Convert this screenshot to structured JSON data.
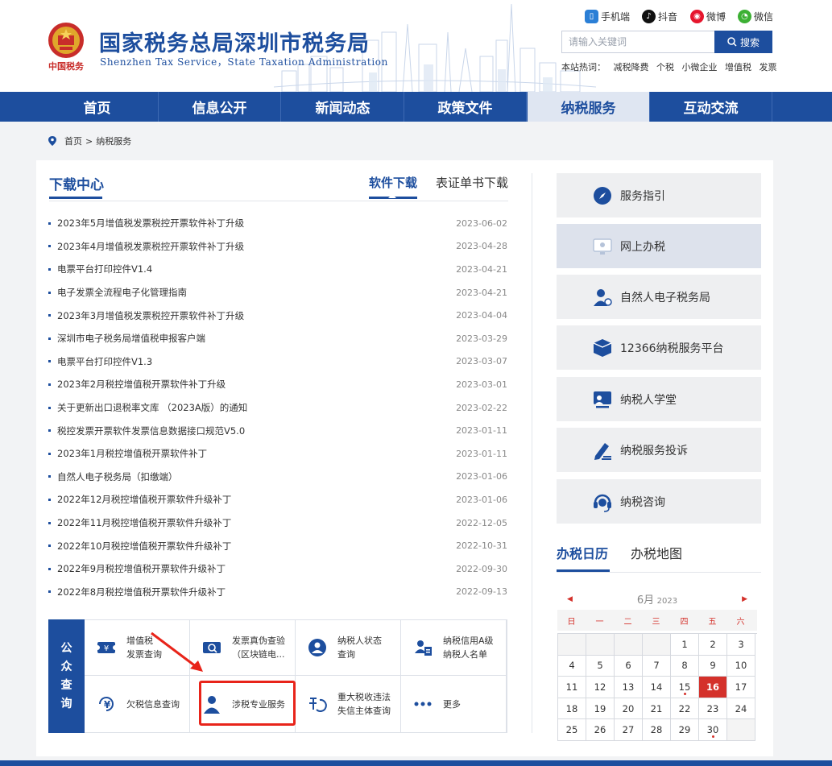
{
  "header": {
    "title": "国家税务总局深圳市税务局",
    "subtitle": "Shenzhen Tax Service，State Taxation Administration",
    "emblem_text": "中国税务",
    "social": [
      "手机端",
      "抖音",
      "微博",
      "微信"
    ],
    "search_placeholder": "请输入关键词",
    "search_button": "搜索",
    "hot_label": "本站热词：",
    "hot_words": [
      "减税降费",
      "个税",
      "小微企业",
      "增值税",
      "发票"
    ]
  },
  "nav": {
    "items": [
      "首页",
      "信息公开",
      "新闻动态",
      "政策文件",
      "纳税服务",
      "互动交流"
    ],
    "active_index": 4
  },
  "breadcrumb": {
    "home": "首页",
    "sep": ">",
    "current": "纳税服务"
  },
  "download": {
    "title": "下载中心",
    "tabs": [
      "软件下载",
      "表证单书下载"
    ],
    "items": [
      {
        "title": "2023年5月增值税发票税控开票软件补丁升级",
        "date": "2023-06-02"
      },
      {
        "title": "2023年4月增值税发票税控开票软件补丁升级",
        "date": "2023-04-28"
      },
      {
        "title": "电票平台打印控件V1.4",
        "date": "2023-04-21"
      },
      {
        "title": "电子发票全流程电子化管理指南",
        "date": "2023-04-21"
      },
      {
        "title": "2023年3月增值税发票税控开票软件补丁升级",
        "date": "2023-04-04"
      },
      {
        "title": "深圳市电子税务局增值税申报客户端",
        "date": "2023-03-29"
      },
      {
        "title": "电票平台打印控件V1.3",
        "date": "2023-03-07"
      },
      {
        "title": "2023年2月税控增值税开票软件补丁升级",
        "date": "2023-03-01"
      },
      {
        "title": "关于更新出口退税率文库 （2023A版）的通知",
        "date": "2023-02-22"
      },
      {
        "title": "税控发票开票软件发票信息数据接口规范V5.0",
        "date": "2023-01-11"
      },
      {
        "title": "2023年1月税控增值税开票软件补丁",
        "date": "2023-01-11"
      },
      {
        "title": "自然人电子税务局（扣缴端）",
        "date": "2023-01-06"
      },
      {
        "title": "2022年12月税控增值税开票软件升级补丁",
        "date": "2023-01-06"
      },
      {
        "title": "2022年11月税控增值税开票软件升级补丁",
        "date": "2022-12-05"
      },
      {
        "title": "2022年10月税控增值税开票软件升级补丁",
        "date": "2022-10-31"
      },
      {
        "title": "2022年9月税控增值税开票软件升级补丁",
        "date": "2022-09-30"
      },
      {
        "title": "2022年8月税控增值税开票软件升级补丁",
        "date": "2022-09-13"
      }
    ]
  },
  "public_query": {
    "label": [
      "公",
      "众",
      "查",
      "询"
    ],
    "cells": [
      {
        "l1": "增值税",
        "l2": "发票查询"
      },
      {
        "l1": "发票真伪查验",
        "l2": "（区块链电..."
      },
      {
        "l1": "纳税人状态",
        "l2": "查询"
      },
      {
        "l1": "纳税信用A级",
        "l2": "纳税人名单"
      },
      {
        "l1": "欠税信息查询",
        "l2": ""
      },
      {
        "l1": "涉税专业服务",
        "l2": ""
      },
      {
        "l1": "重大税收违法",
        "l2": "失信主体查询"
      },
      {
        "l1": "更多",
        "l2": ""
      }
    ]
  },
  "services": {
    "items": [
      "服务指引",
      "网上办税",
      "自然人电子税务局",
      "12366纳税服务平台",
      "纳税人学堂",
      "纳税服务投诉",
      "纳税咨询"
    ],
    "active_index": 1
  },
  "calendar": {
    "tabs": [
      "办税日历",
      "办税地图"
    ],
    "month": "6月",
    "year": "2023",
    "prev": "◀",
    "next": "▶",
    "weekdays": [
      "日",
      "一",
      "二",
      "三",
      "四",
      "五",
      "六"
    ],
    "leading_empty": 4,
    "days_in_month": 30,
    "today": 16,
    "marked": [
      15,
      30
    ]
  },
  "colors": {
    "brand": "#1d4e9e",
    "highlight": "#e8241a",
    "today": "#d4312b"
  }
}
